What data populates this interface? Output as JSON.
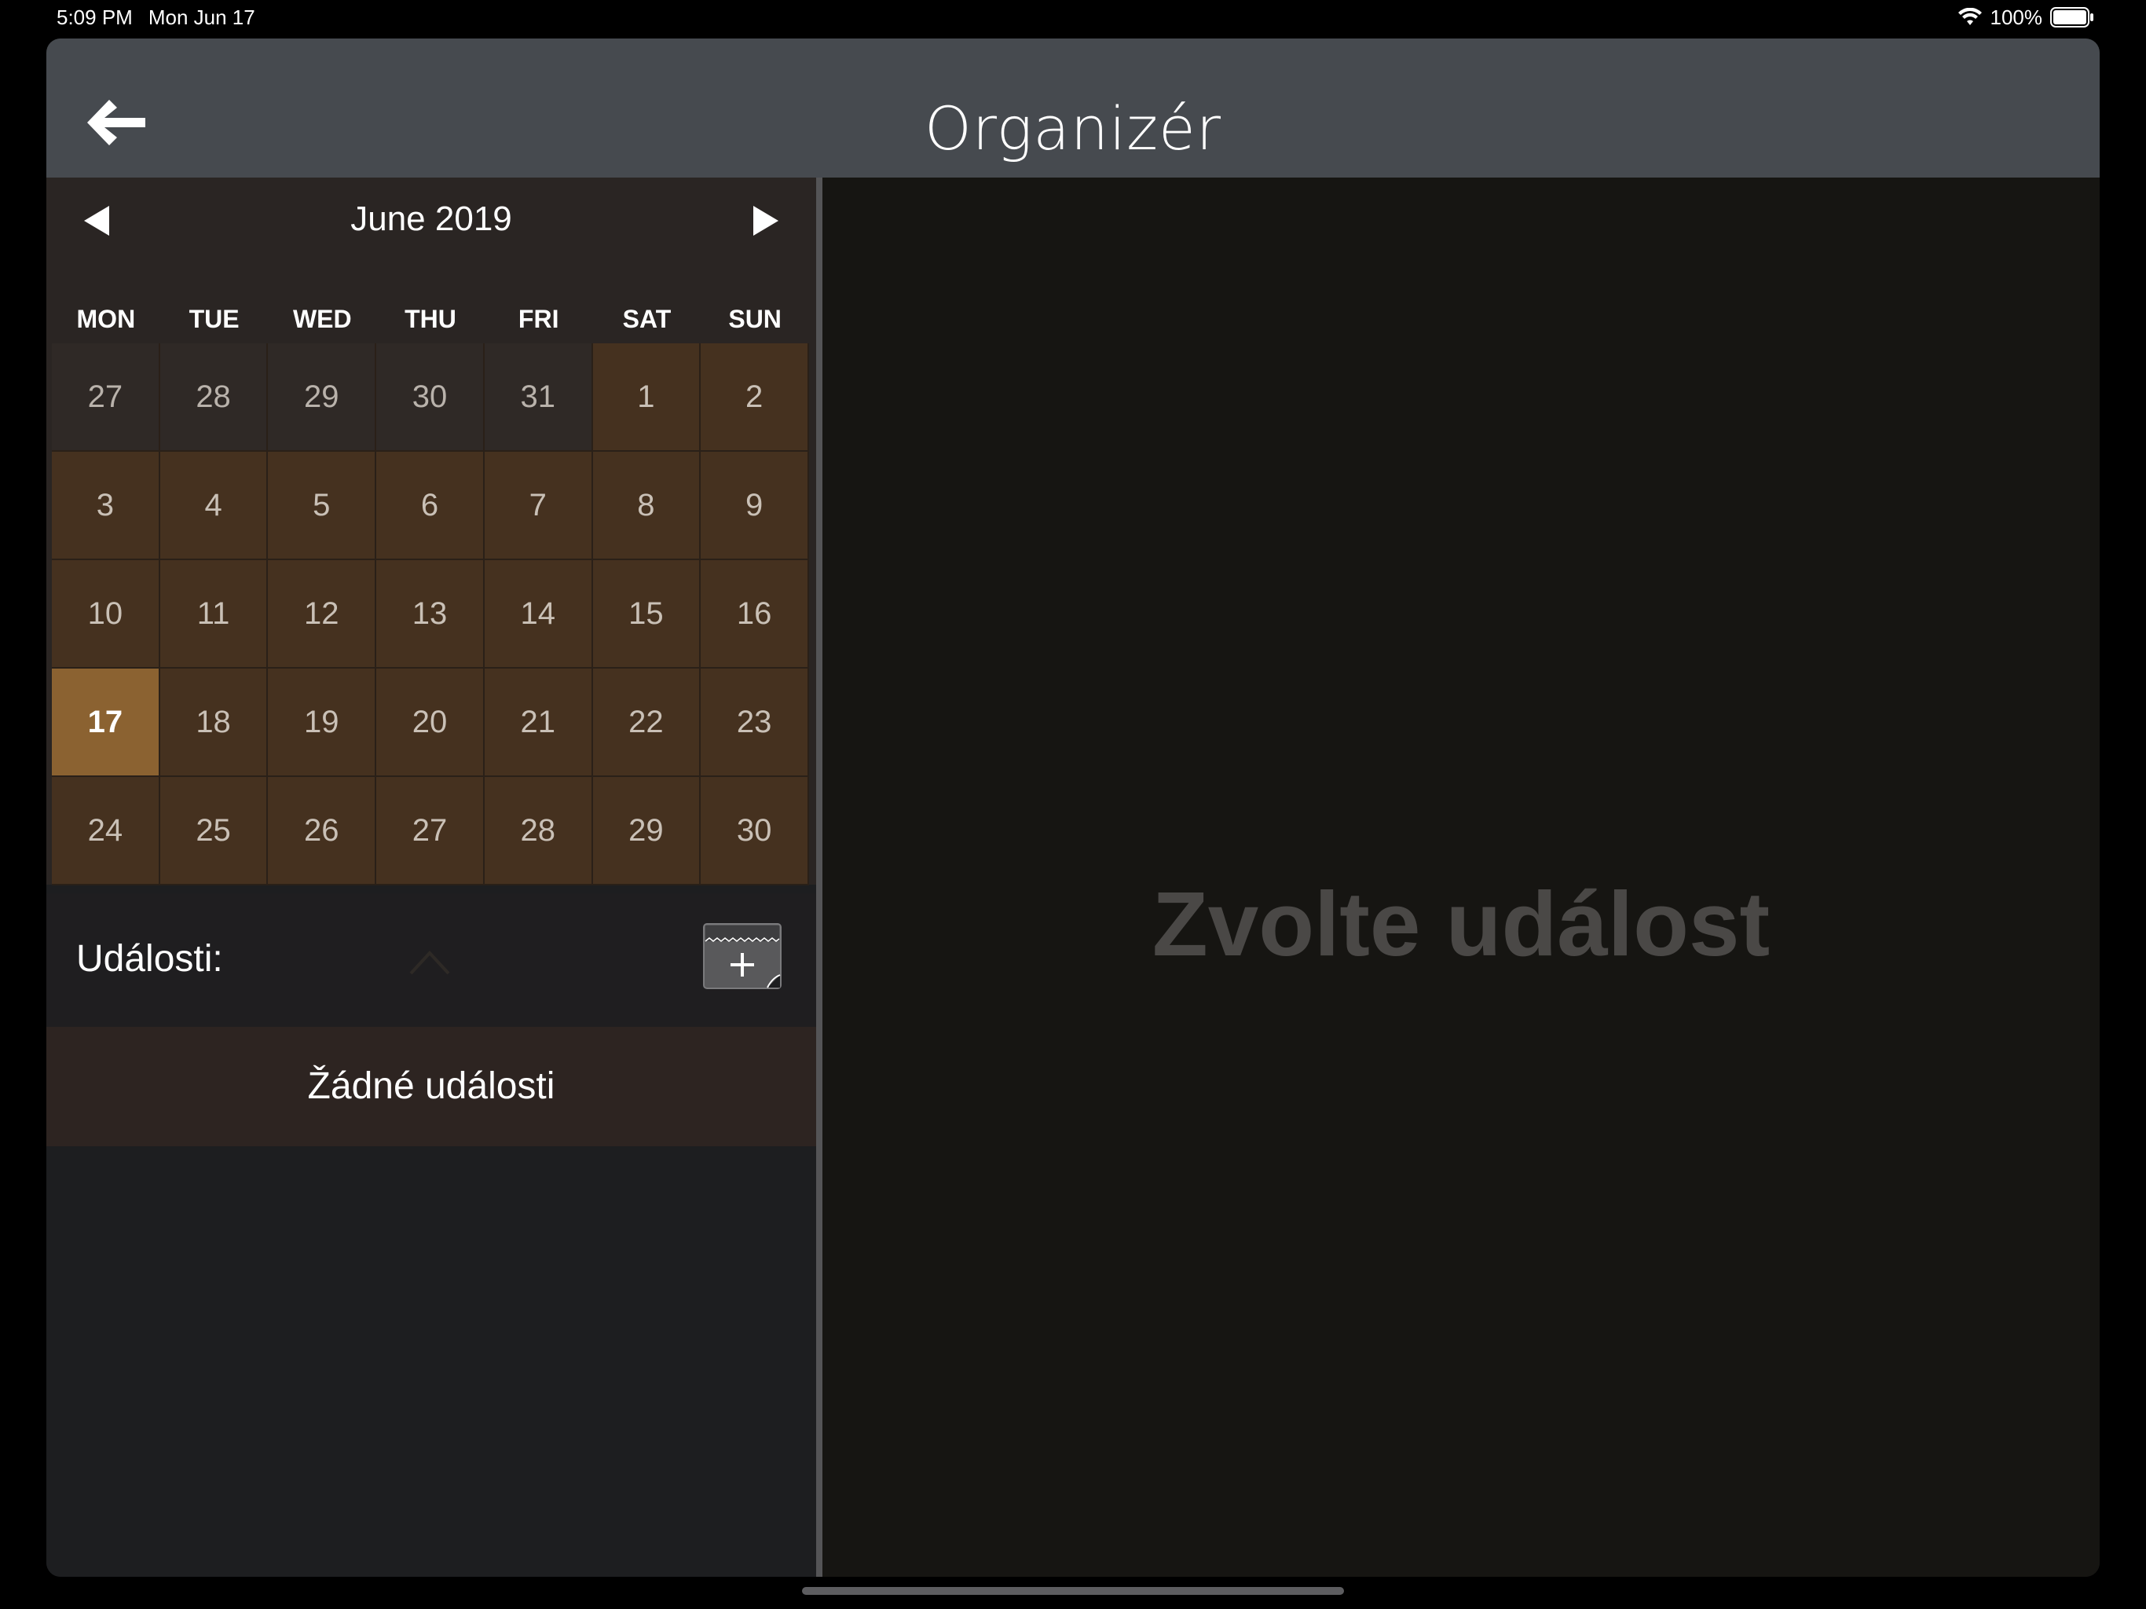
{
  "status_bar": {
    "time": "5:09 PM",
    "date": "Mon Jun 17",
    "battery": "100%"
  },
  "navbar": {
    "title": "Organizér",
    "back_icon": "arrow-left-icon"
  },
  "calendar": {
    "month_title": "June 2019",
    "prev_icon": "triangle-left-icon",
    "next_icon": "triangle-right-icon",
    "weekdays": [
      "MON",
      "TUE",
      "WED",
      "THU",
      "FRI",
      "SAT",
      "SUN"
    ],
    "weeks": [
      [
        "27",
        "28",
        "29",
        "30",
        "31",
        "1",
        "2"
      ],
      [
        "3",
        "4",
        "5",
        "6",
        "7",
        "8",
        "9"
      ],
      [
        "10",
        "11",
        "12",
        "13",
        "14",
        "15",
        "16"
      ],
      [
        "17",
        "18",
        "19",
        "20",
        "21",
        "22",
        "23"
      ],
      [
        "24",
        "25",
        "26",
        "27",
        "28",
        "29",
        "30"
      ]
    ],
    "selected_day": "17",
    "colors": {
      "month_day": "#45311f",
      "other_month_day": "#2f2926",
      "today": "#8b6231"
    }
  },
  "events": {
    "label": "Události:",
    "empty_text": "Žádné události",
    "collapse_icon": "chevron-up-icon",
    "add_icon": "calendar-add-icon"
  },
  "detail": {
    "placeholder": "Zvolte událost"
  }
}
